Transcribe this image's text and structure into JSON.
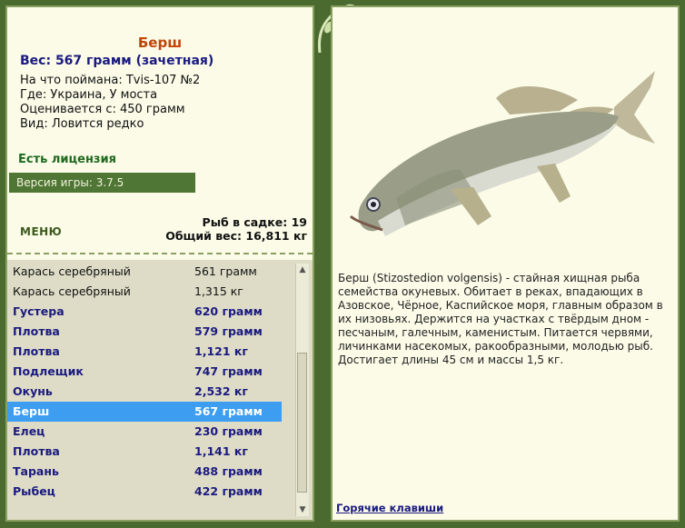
{
  "fish": {
    "name": "Берш",
    "weight_line": "Вес: 567 грамм (зачетная)",
    "bait": "На что поймана: Tvis-107 №2",
    "place": "Где: Украина, У моста",
    "valued_from": "Оценивается с: 450 грамм",
    "kind": "Вид: Ловится редко"
  },
  "license": "Есть лицензия",
  "version": "Версия игры: 3.7.5",
  "menu_label": "МЕНЮ",
  "summary": {
    "count": "Рыб в садке: 19",
    "total": "Общий вес: 16,811 кг"
  },
  "catch_list": [
    {
      "name": "Карась серебряный",
      "weight": "561 грамм",
      "style": "plain"
    },
    {
      "name": "Карась серебряный",
      "weight": "1,315 кг",
      "style": "plain"
    },
    {
      "name": "Густера",
      "weight": "620 грамм",
      "style": "bold"
    },
    {
      "name": "Плотва",
      "weight": "579 грамм",
      "style": "bold"
    },
    {
      "name": "Плотва",
      "weight": "1,121 кг",
      "style": "bold"
    },
    {
      "name": "Подлещик",
      "weight": "747 грамм",
      "style": "bold"
    },
    {
      "name": "Окунь",
      "weight": "2,532 кг",
      "style": "bold"
    },
    {
      "name": "Берш",
      "weight": "567 грамм",
      "style": "sel"
    },
    {
      "name": "Елец",
      "weight": "230 грамм",
      "style": "bold"
    },
    {
      "name": "Плотва",
      "weight": "1,141 кг",
      "style": "bold"
    },
    {
      "name": "Тарань",
      "weight": "488 грамм",
      "style": "bold"
    },
    {
      "name": "Рыбец",
      "weight": "422 грамм",
      "style": "bold"
    }
  ],
  "description": "Берш (Stizostedion volgensis) - стайная хищная рыба семейства окуневых. Обитает в реках, впадающих в Азовское, Чёрное, Каспийское моря, главным образом в их низовьях. Держится на участках с твёрдым дном - песчаным, галечным, каменистым. Питается червями, личинками насекомых, ракообразными, молодью рыб. Достигает длины 45 см и массы 1,5 кг.",
  "hotkeys_link": "Горячие клавиши",
  "colors": {
    "frame": "#4a6a30",
    "panel": "#fbfbe8",
    "selected": "#3d9df0",
    "name_accent": "#c0450a"
  }
}
